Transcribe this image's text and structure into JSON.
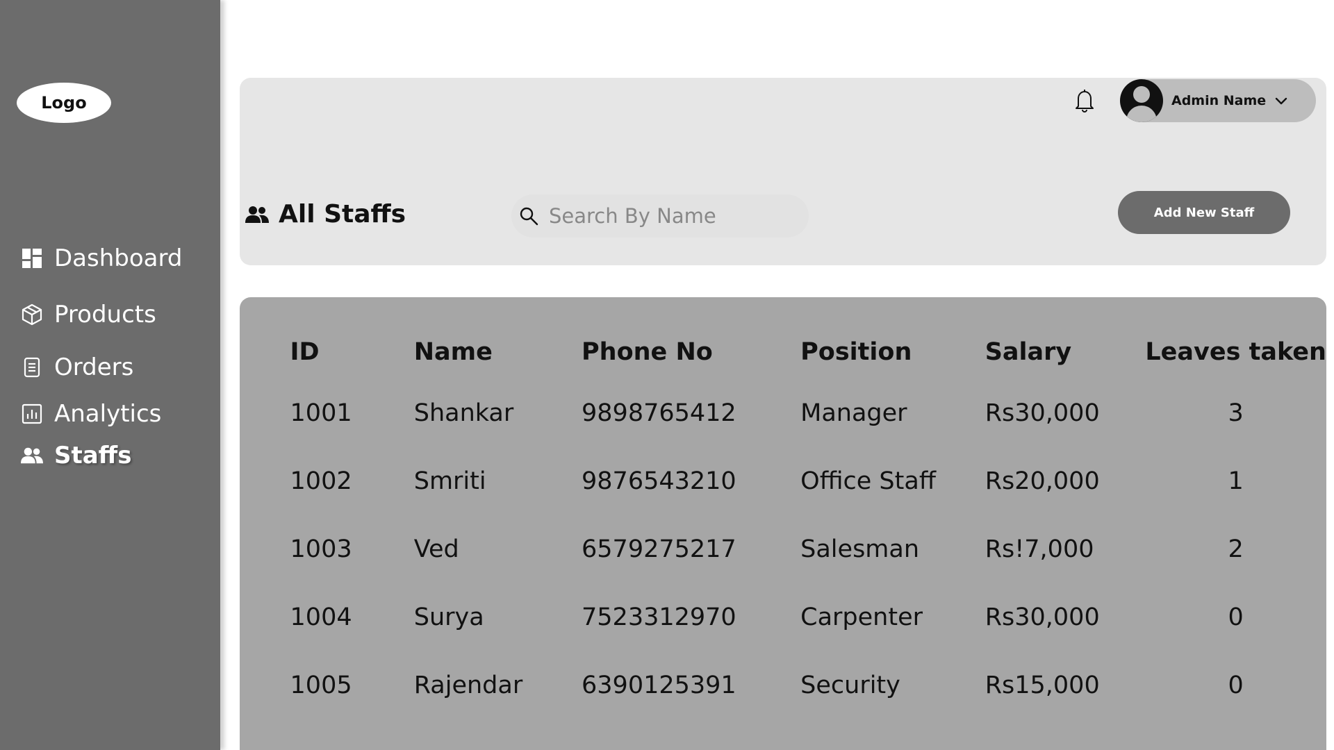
{
  "sidebar": {
    "logo": "Logo",
    "items": [
      {
        "label": "Dashboard",
        "icon": "dashboard-icon",
        "active": false
      },
      {
        "label": "Products",
        "icon": "box-icon",
        "active": false
      },
      {
        "label": "Orders",
        "icon": "document-icon",
        "active": false
      },
      {
        "label": "Analytics",
        "icon": "analytics-icon",
        "active": false
      },
      {
        "label": "Staffs",
        "icon": "people-icon",
        "active": true
      }
    ]
  },
  "header": {
    "admin_name": "Admin Name",
    "page_title": "All Staffs",
    "search_placeholder": "Search By Name",
    "add_button": "Add New Staff"
  },
  "table": {
    "columns": [
      "ID",
      "Name",
      "Phone No",
      "Position",
      "Salary",
      "Leaves taken"
    ],
    "rows": [
      [
        "1001",
        "Shankar",
        "9898765412",
        "Manager",
        "Rs30,000",
        "3"
      ],
      [
        "1002",
        "Smriti",
        "9876543210",
        "Office Staff",
        "Rs20,000",
        "1"
      ],
      [
        "1003",
        "Ved",
        "6579275217",
        "Salesman",
        "Rs!7,000",
        "2"
      ],
      [
        "1004",
        "Surya",
        "7523312970",
        "Carpenter",
        "Rs30,000",
        "0"
      ],
      [
        "1005",
        "Rajendar",
        "6390125391",
        "Security",
        "Rs15,000",
        "0"
      ]
    ]
  },
  "colors": {
    "sidebar_bg": "#6c6c6c",
    "header_bg": "#e6e6e6",
    "table_bg": "#a6a6a6",
    "button_bg": "#6c6c6c"
  }
}
